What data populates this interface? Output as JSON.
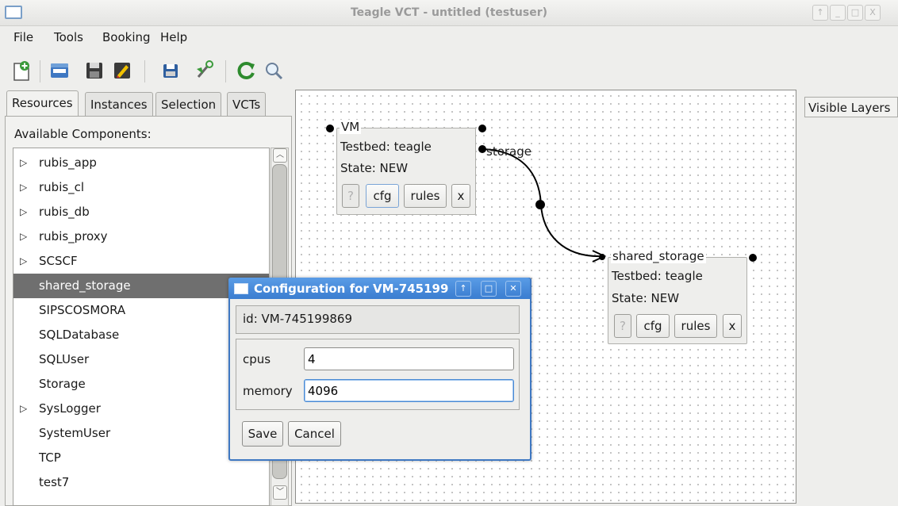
{
  "window": {
    "title": "Teagle VCT - untitled (testuser)",
    "controls": [
      "↑",
      "_",
      "□",
      "X"
    ]
  },
  "menubar": {
    "items": [
      "File",
      "Tools",
      "Booking",
      "Help"
    ]
  },
  "toolbar": {
    "icons": [
      "new-document-icon",
      "open-icon",
      "save-icon",
      "edit-icon",
      "save-as-icon",
      "settings-icon",
      "refresh-icon",
      "search-icon"
    ]
  },
  "left_panel": {
    "tabs": [
      "Resources",
      "Instances",
      "Selection",
      "VCTs"
    ],
    "active_tab": "Resources",
    "heading": "Available Components:",
    "items": [
      {
        "label": "rubis_app",
        "expandable": true
      },
      {
        "label": "rubis_cl",
        "expandable": true
      },
      {
        "label": "rubis_db",
        "expandable": true
      },
      {
        "label": "rubis_proxy",
        "expandable": true
      },
      {
        "label": "SCSCF",
        "expandable": true
      },
      {
        "label": "shared_storage",
        "expandable": false,
        "selected": true
      },
      {
        "label": "SIPSCOSMORA",
        "expandable": false
      },
      {
        "label": "SQLDatabase",
        "expandable": false
      },
      {
        "label": "SQLUser",
        "expandable": false
      },
      {
        "label": "Storage",
        "expandable": false
      },
      {
        "label": "SysLogger",
        "expandable": true
      },
      {
        "label": "SystemUser",
        "expandable": false
      },
      {
        "label": "TCP",
        "expandable": false
      },
      {
        "label": "test7",
        "expandable": false
      }
    ],
    "expand_glyph": "▷"
  },
  "right_panel": {
    "visible_layers_label": "Visible Layers"
  },
  "canvas": {
    "nodes": [
      {
        "title": "VM",
        "testbed": "Testbed: teagle",
        "state": "State: NEW",
        "buttons": {
          "help": "?",
          "cfg": "cfg",
          "rules": "rules",
          "close": "x"
        }
      },
      {
        "title": "shared_storage",
        "testbed": "Testbed: teagle",
        "state": "State: NEW",
        "buttons": {
          "help": "?",
          "cfg": "cfg",
          "rules": "rules",
          "close": "x"
        }
      }
    ],
    "connection_label": "storage"
  },
  "dialog": {
    "title": "Configuration for VM-745199",
    "controls": [
      "↑",
      "□",
      "✕"
    ],
    "id_text": "id: VM-745199869",
    "fields": [
      {
        "label": "cpus",
        "value": "4"
      },
      {
        "label": "memory",
        "value": "4096"
      }
    ],
    "save_label": "Save",
    "cancel_label": "Cancel"
  },
  "colors": {
    "dialog_accent": "#3f78c2",
    "selection": "#6f6f6f",
    "refresh_icon": "#2e8b2e"
  }
}
